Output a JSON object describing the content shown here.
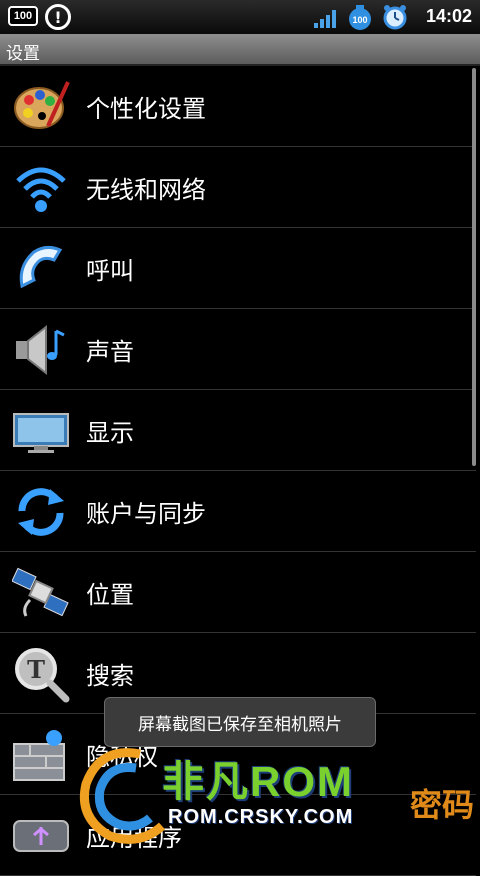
{
  "status_bar": {
    "battery_badge": "100",
    "alert_icon": "alert-circle-icon",
    "signal_icon": "signal-bars-icon",
    "battery_level": "100",
    "alarm_icon": "alarm-clock-icon",
    "time": "14:02"
  },
  "title_bar": {
    "title": "设置"
  },
  "settings": {
    "items": [
      {
        "label": "个性化设置",
        "icon": "palette-icon"
      },
      {
        "label": "无线和网络",
        "icon": "wifi-icon"
      },
      {
        "label": "呼叫",
        "icon": "phone-handset-icon"
      },
      {
        "label": "声音",
        "icon": "speaker-music-icon"
      },
      {
        "label": "显示",
        "icon": "monitor-icon"
      },
      {
        "label": "账户与同步",
        "icon": "sync-arrows-icon"
      },
      {
        "label": "位置",
        "icon": "satellite-icon"
      },
      {
        "label": "搜索",
        "icon": "search-magnifier-icon"
      },
      {
        "label": "隐私权",
        "icon": "firewall-icon"
      },
      {
        "label": "应用程序",
        "icon": "usb-icon"
      }
    ]
  },
  "toast": {
    "message": "屏幕截图已保存至相机照片"
  },
  "watermark": {
    "brand": "非凡ROM",
    "url": "ROM.CRSKY.COM",
    "side_text": "密码"
  },
  "colors": {
    "background": "#000000",
    "watermark_green": "#7ad12d",
    "watermark_blue": "#1d3d7a",
    "watermark_orange": "#e08a1a"
  }
}
